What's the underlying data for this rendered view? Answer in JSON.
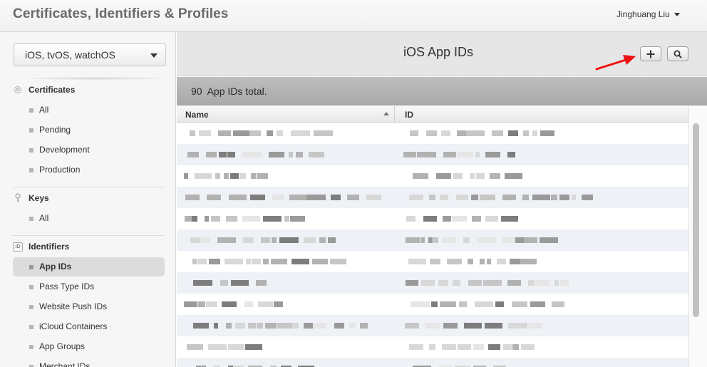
{
  "header": {
    "app_title": "Certificates, Identifiers & Profiles",
    "user_name": "Jinghuang Liu"
  },
  "sidebar": {
    "platform": "iOS, tvOS, watchOS",
    "sections": {
      "certificates": {
        "title": "Certificates",
        "items": [
          "All",
          "Pending",
          "Development",
          "Production"
        ]
      },
      "keys": {
        "title": "Keys",
        "items": [
          "All"
        ]
      },
      "identifiers": {
        "title": "Identifiers",
        "icon_text": "ID",
        "items": [
          "App IDs",
          "Pass Type IDs",
          "Website Push IDs",
          "iCloud Containers",
          "App Groups",
          "Merchant IDs"
        ],
        "active": "App IDs"
      }
    }
  },
  "main": {
    "title": "iOS App IDs",
    "count_number": "90",
    "count_label": "App IDs total.",
    "add_icon": "plus-icon",
    "search_icon": "search-icon",
    "columns": {
      "name": "Name",
      "id": "ID"
    },
    "sort": "name-ascending",
    "row_content": "pixelated (obscured)"
  },
  "colors": {
    "annotation_arrow": "#ee1111",
    "active_nav": "#dcdcdc",
    "row_alt": "#eef1f5"
  }
}
